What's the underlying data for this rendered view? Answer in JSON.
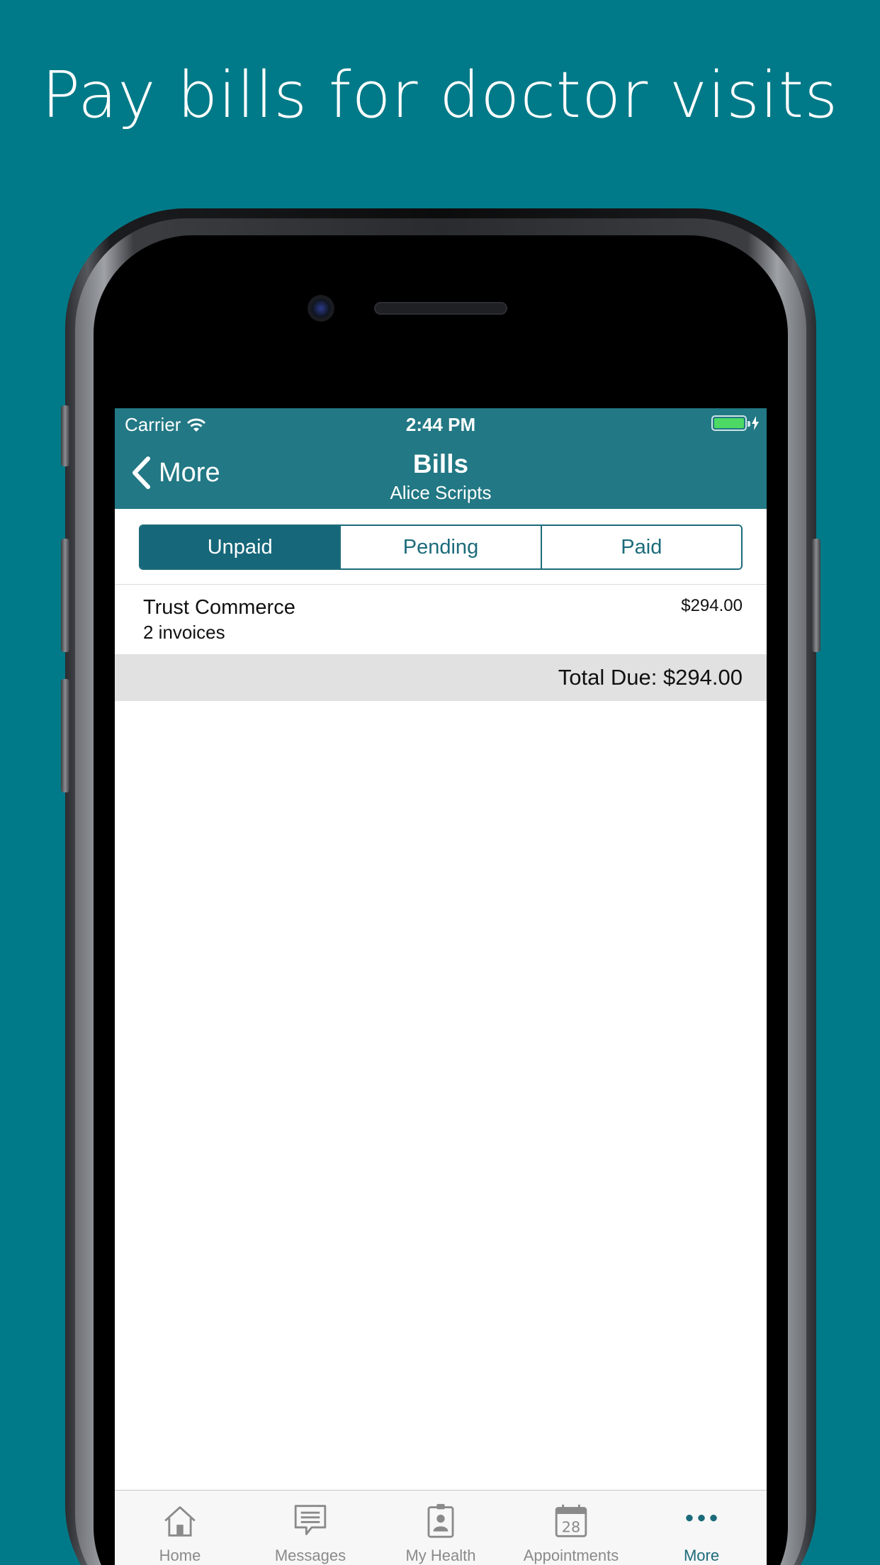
{
  "headline": "Pay bills for doctor visits",
  "status_bar": {
    "carrier": "Carrier",
    "time": "2:44 PM"
  },
  "nav": {
    "back_label": "More",
    "title": "Bills",
    "subtitle": "Alice Scripts"
  },
  "segments": [
    {
      "label": "Unpaid",
      "selected": true
    },
    {
      "label": "Pending",
      "selected": false
    },
    {
      "label": "Paid",
      "selected": false
    }
  ],
  "bills": [
    {
      "payee": "Trust Commerce",
      "detail": "2 invoices",
      "amount": "$294.00"
    }
  ],
  "total": "Total Due: $294.00",
  "tabs": [
    {
      "label": "Home",
      "icon": "house-icon",
      "selected": false
    },
    {
      "label": "Messages",
      "icon": "message-icon",
      "selected": false
    },
    {
      "label": "My Health",
      "icon": "clipboard-icon",
      "selected": false
    },
    {
      "label": "Appointments",
      "icon": "calendar-icon",
      "calendar_day": "28",
      "selected": false
    },
    {
      "label": "More",
      "icon": "more-dots-icon",
      "selected": true
    }
  ],
  "colors": {
    "background": "#007a88",
    "nav_bar": "#227884",
    "accent": "#16677a",
    "tab_inactive": "#8a8a8a",
    "battery": "#4cd964"
  }
}
